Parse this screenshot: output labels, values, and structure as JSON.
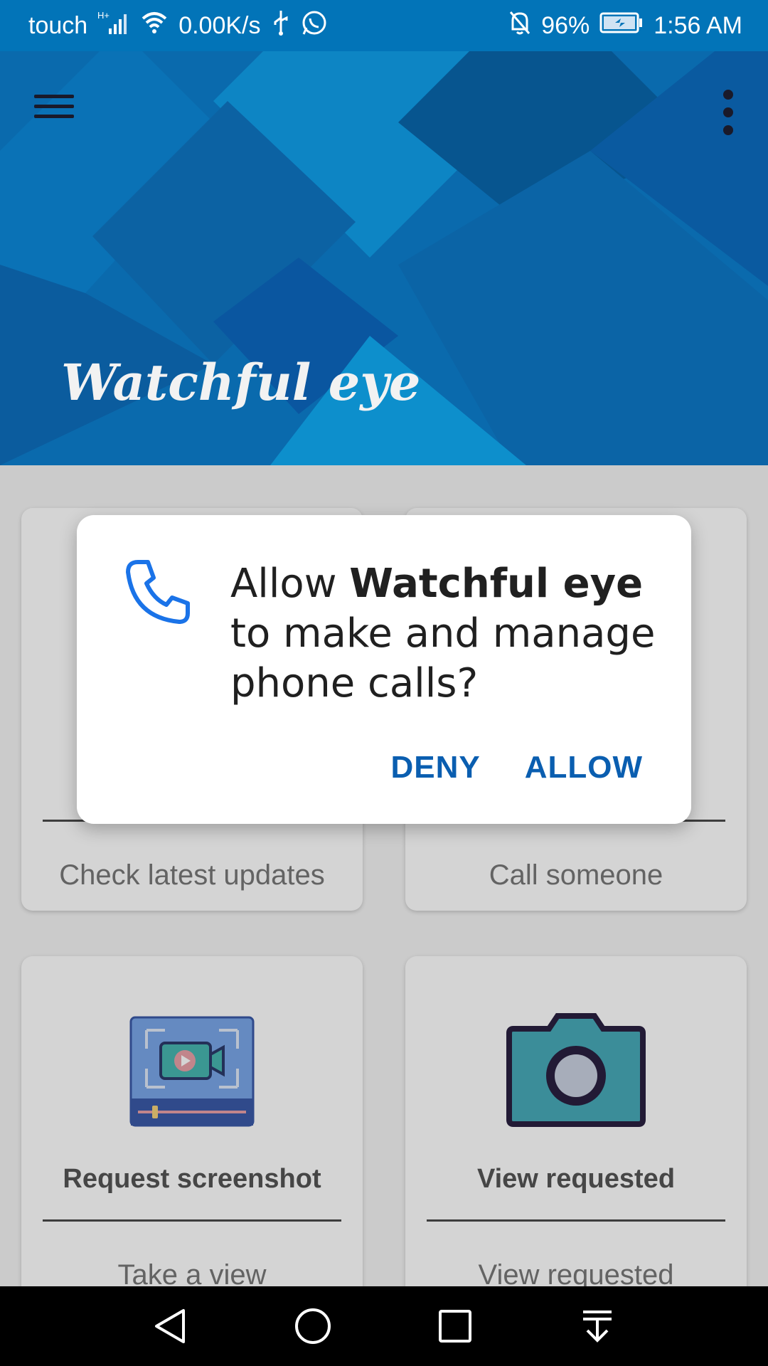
{
  "status_bar": {
    "carrier": "touch",
    "net_speed": "0.00K/s",
    "battery": "96%",
    "time": "1:56 AM",
    "icons": [
      "signal-icon",
      "wifi-icon",
      "usb-icon",
      "whatsapp-icon",
      "notifications-off-icon",
      "battery-charging-icon"
    ]
  },
  "header": {
    "app_title": "Watchful eye",
    "menu_icon": "hamburger-menu-icon",
    "more_icon": "more-vert-icon",
    "colors": {
      "primary": "#0274b8",
      "hero_dark": "#0a5c9c",
      "hero_light": "#0d85c4"
    }
  },
  "cards": [
    {
      "title": "",
      "subtitle": "Check latest updates"
    },
    {
      "title": "",
      "subtitle": "Call someone"
    },
    {
      "title": "Request screenshot",
      "subtitle": "Take a view",
      "icon": "video-screenshot-icon"
    },
    {
      "title": "View requested",
      "subtitle": "View requested",
      "icon": "camera-icon"
    }
  ],
  "dialog": {
    "msg_pre": "Allow ",
    "app_name": "Watchful eye",
    "msg_post": " to make and manage phone calls?",
    "icon": "phone-icon",
    "deny_label": "DENY",
    "allow_label": "ALLOW",
    "accent": "#0a5eb0"
  },
  "nav_bar": {
    "buttons": [
      "back-icon",
      "home-icon",
      "recents-icon",
      "notification-pull-icon"
    ]
  }
}
